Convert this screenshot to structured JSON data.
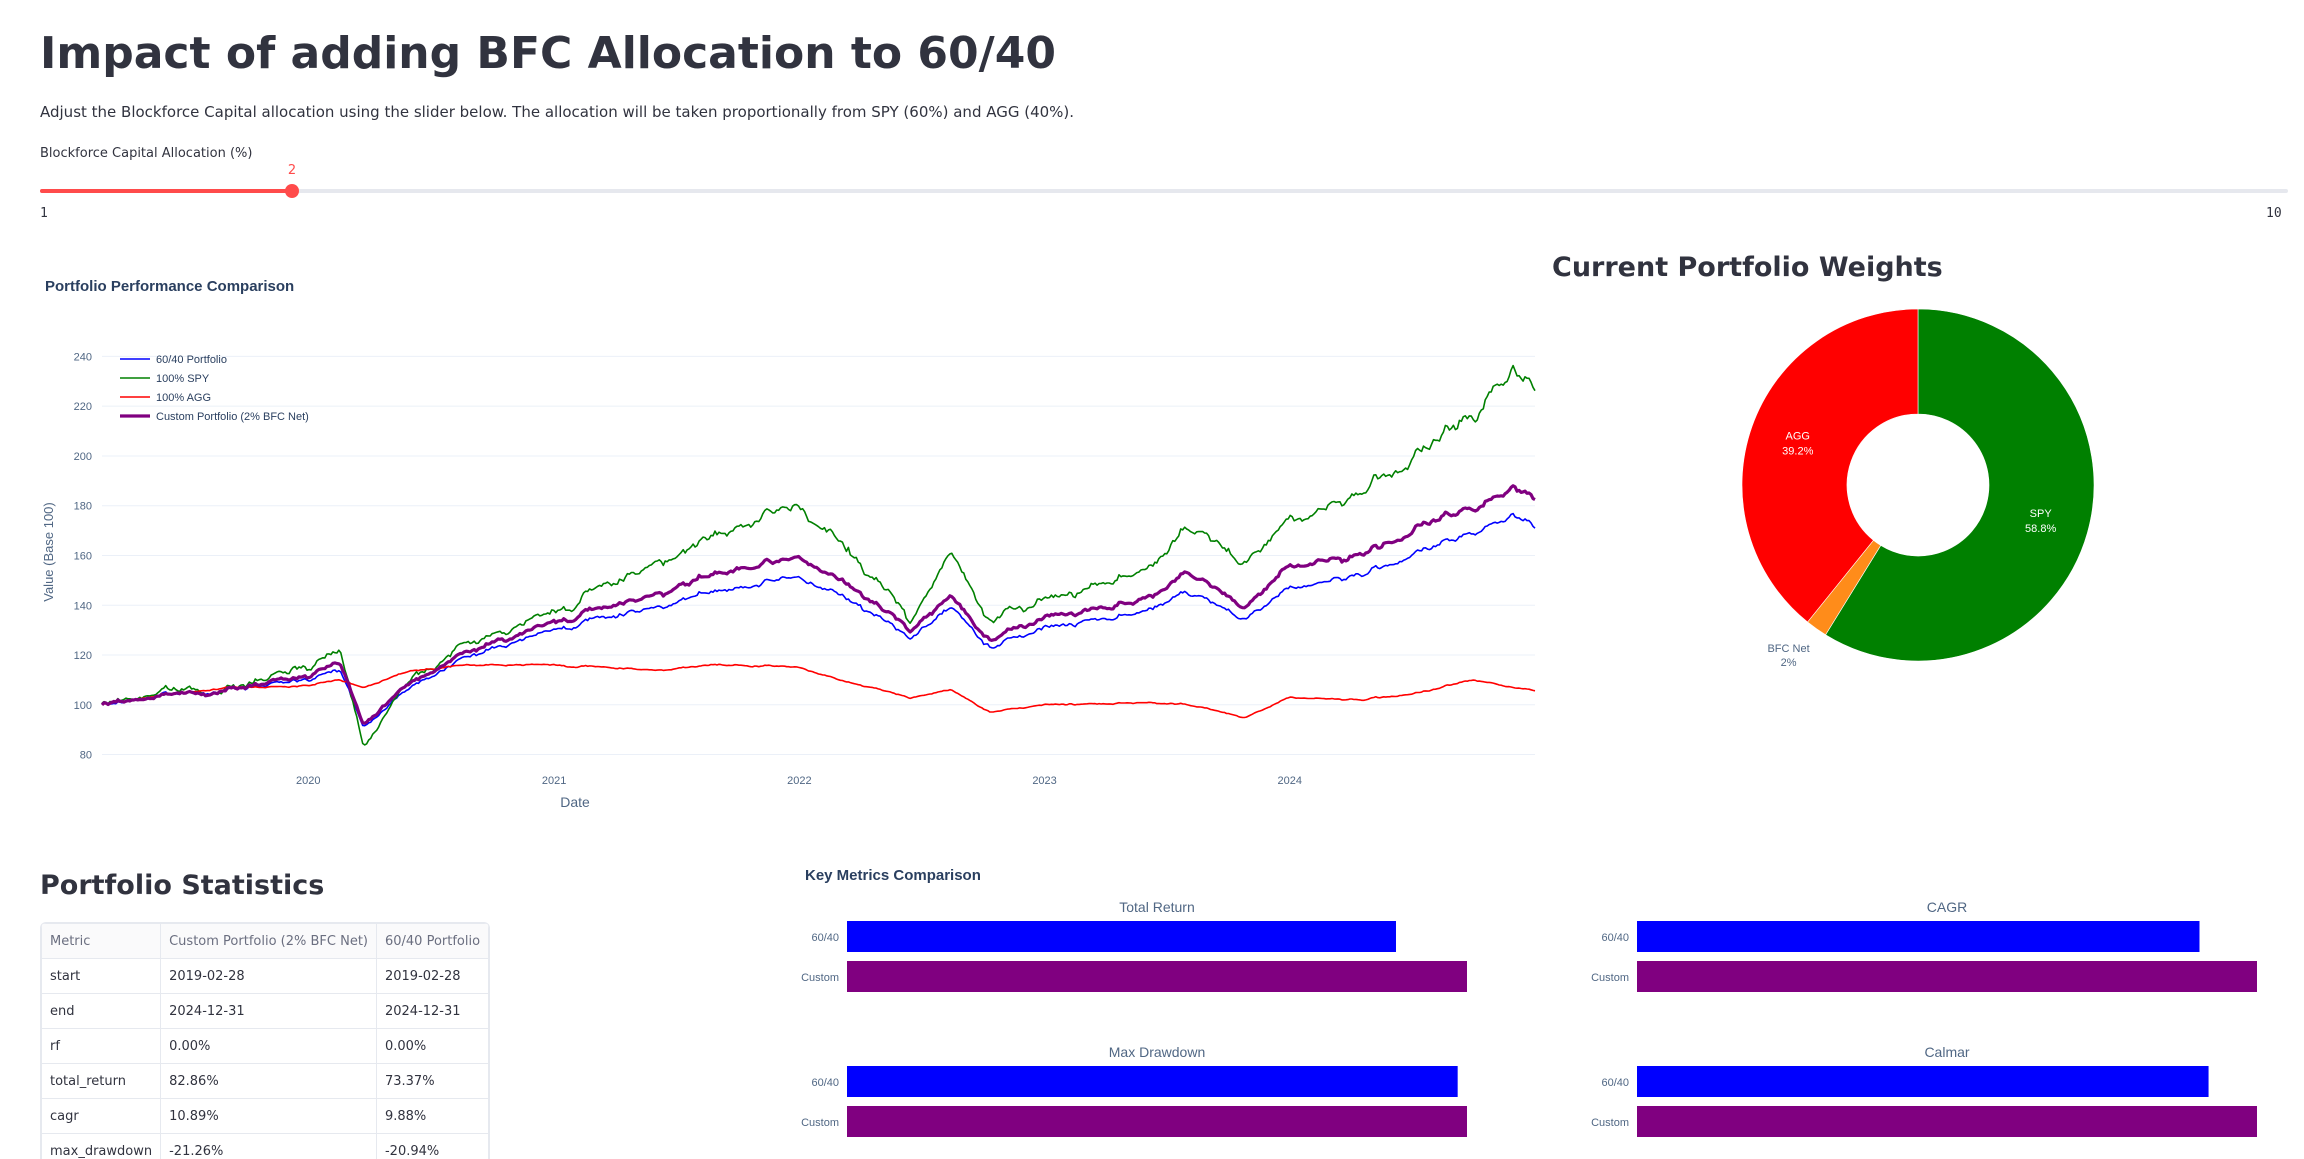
{
  "page": {
    "title": "Impact of adding BFC Allocation to 60/40",
    "intro": "Adjust the Blockforce Capital allocation using the slider below. The allocation will be taken proportionally from SPY (60%) and AGG (40%)."
  },
  "slider": {
    "label": "Blockforce Capital Allocation (%)",
    "min": 1,
    "max": 10,
    "value": 2,
    "min_label": "1",
    "max_label": "10",
    "value_label": "2",
    "color": "#ff4b4b"
  },
  "performance": {
    "title": "Portfolio Performance Comparison",
    "ylabel": "Value (Base 100)",
    "xlabel": "Date"
  },
  "weights": {
    "title": "Current Portfolio Weights"
  },
  "statistics": {
    "title": "Portfolio Statistics",
    "headers": [
      "Metric",
      "Custom Portfolio (2% BFC Net)",
      "60/40 Portfolio"
    ],
    "rows": [
      [
        "start",
        "2019-02-28",
        "2019-02-28"
      ],
      [
        "end",
        "2024-12-31",
        "2024-12-31"
      ],
      [
        "rf",
        "0.00%",
        "0.00%"
      ],
      [
        "total_return",
        "82.86%",
        "73.37%"
      ],
      [
        "cagr",
        "10.89%",
        "9.88%"
      ],
      [
        "max_drawdown",
        "-21.26%",
        "-20.94%"
      ]
    ]
  },
  "metrics": {
    "title": "Key Metrics Comparison"
  },
  "chart_data": [
    {
      "type": "line",
      "title": "Portfolio Performance Comparison",
      "xlabel": "Date",
      "ylabel": "Value (Base 100)",
      "x_ticks": [
        "2020",
        "2021",
        "2022",
        "2023",
        "2024"
      ],
      "y_ticks": [
        80,
        100,
        120,
        140,
        160,
        180,
        200,
        220,
        240
      ],
      "xlim": [
        "2019-02-28",
        "2024-12-31"
      ],
      "ylim": [
        75,
        247
      ],
      "grid": true,
      "legend_position": "top-left",
      "series": [
        {
          "name": "60/40 Portfolio",
          "color": "#0000ff",
          "x": [
            "2019-02-28",
            "2019-06-01",
            "2019-09-01",
            "2019-12-01",
            "2020-02-19",
            "2020-03-23",
            "2020-06-01",
            "2020-09-01",
            "2020-12-31",
            "2021-06-01",
            "2021-09-01",
            "2021-12-31",
            "2022-03-01",
            "2022-06-15",
            "2022-08-15",
            "2022-10-12",
            "2023-01-01",
            "2023-06-01",
            "2023-07-31",
            "2023-10-27",
            "2023-12-31",
            "2024-04-19",
            "2024-07-15",
            "2024-10-01",
            "2024-11-29",
            "2024-12-31"
          ],
          "values": [
            100,
            104,
            106,
            109,
            114,
            91,
            108,
            120,
            130,
            140,
            145,
            151,
            144,
            128,
            139,
            123,
            131,
            138,
            145,
            135,
            147,
            152,
            162,
            168,
            177,
            173
          ]
        },
        {
          "name": "100% SPY",
          "color": "#008000",
          "x": [
            "2019-02-28",
            "2019-06-01",
            "2019-09-01",
            "2019-12-01",
            "2020-02-19",
            "2020-03-23",
            "2020-06-01",
            "2020-09-01",
            "2020-12-31",
            "2021-06-01",
            "2021-09-01",
            "2021-12-31",
            "2022-03-01",
            "2022-06-15",
            "2022-08-15",
            "2022-10-12",
            "2023-01-01",
            "2023-06-01",
            "2023-07-31",
            "2023-10-27",
            "2023-12-31",
            "2024-04-19",
            "2024-07-15",
            "2024-10-01",
            "2024-11-29",
            "2024-12-31"
          ],
          "values": [
            100,
            106,
            106,
            113,
            122,
            83,
            112,
            125,
            137,
            158,
            167,
            180,
            165,
            135,
            160,
            134,
            142,
            155,
            170,
            158,
            175,
            185,
            203,
            215,
            236,
            230
          ]
        },
        {
          "name": "100% AGG",
          "color": "#ff0000",
          "x": [
            "2019-02-28",
            "2019-06-01",
            "2019-09-01",
            "2019-12-01",
            "2020-02-19",
            "2020-03-23",
            "2020-06-01",
            "2020-09-01",
            "2020-12-31",
            "2021-06-01",
            "2021-09-01",
            "2021-12-31",
            "2022-03-01",
            "2022-06-15",
            "2022-08-15",
            "2022-10-12",
            "2023-01-01",
            "2023-06-01",
            "2023-07-31",
            "2023-10-27",
            "2023-12-31",
            "2024-04-19",
            "2024-07-15",
            "2024-10-01",
            "2024-11-29",
            "2024-12-31"
          ],
          "values": [
            100,
            104,
            107,
            107,
            110,
            107,
            114,
            116,
            116,
            114,
            116,
            115,
            110,
            103,
            106,
            97,
            100,
            101,
            100,
            95,
            103,
            102,
            105,
            110,
            107,
            106
          ]
        },
        {
          "name": "Custom Portfolio (2% BFC Net)",
          "color": "#800080",
          "x": [
            "2019-02-28",
            "2019-06-01",
            "2019-09-01",
            "2019-12-01",
            "2020-02-19",
            "2020-03-23",
            "2020-06-01",
            "2020-09-01",
            "2020-12-31",
            "2021-06-01",
            "2021-09-01",
            "2021-12-31",
            "2022-03-01",
            "2022-06-15",
            "2022-08-15",
            "2022-10-12",
            "2023-01-01",
            "2023-06-01",
            "2023-07-31",
            "2023-10-27",
            "2023-12-31",
            "2024-04-19",
            "2024-07-15",
            "2024-10-01",
            "2024-11-29",
            "2024-12-31"
          ],
          "values": [
            100,
            104,
            106,
            110,
            117,
            92,
            110,
            122,
            133,
            145,
            152,
            159,
            150,
            131,
            143,
            126,
            135,
            143,
            152,
            140,
            156,
            160,
            172,
            178,
            188,
            184
          ]
        }
      ]
    },
    {
      "type": "pie",
      "title": "Current Portfolio Weights",
      "hole": true,
      "slices": [
        {
          "label": "SPY",
          "value": 58.8,
          "text": "58.8%",
          "color": "#008000"
        },
        {
          "label": "BFC Net",
          "value": 2,
          "text": "2%",
          "color": "#ff8c1a"
        },
        {
          "label": "AGG",
          "value": 39.2,
          "text": "39.2%",
          "color": "#ff0000"
        }
      ]
    },
    {
      "type": "bar",
      "title": "Total Return",
      "orientation": "horizontal",
      "categories": [
        "60/40",
        "Custom"
      ],
      "values": [
        73.37,
        82.86
      ],
      "colors": [
        "#0000ff",
        "#800080"
      ]
    },
    {
      "type": "bar",
      "title": "CAGR",
      "orientation": "horizontal",
      "categories": [
        "60/40",
        "Custom"
      ],
      "values": [
        9.88,
        10.89
      ],
      "colors": [
        "#0000ff",
        "#800080"
      ]
    },
    {
      "type": "bar",
      "title": "Max Drawdown",
      "orientation": "horizontal",
      "categories": [
        "60/40",
        "Custom"
      ],
      "values": [
        20.94,
        21.26
      ],
      "colors": [
        "#0000ff",
        "#800080"
      ]
    },
    {
      "type": "bar",
      "title": "Calmar",
      "orientation": "horizontal",
      "categories": [
        "60/40",
        "Custom"
      ],
      "values": [
        0.472,
        0.512
      ],
      "colors": [
        "#0000ff",
        "#800080"
      ]
    }
  ]
}
